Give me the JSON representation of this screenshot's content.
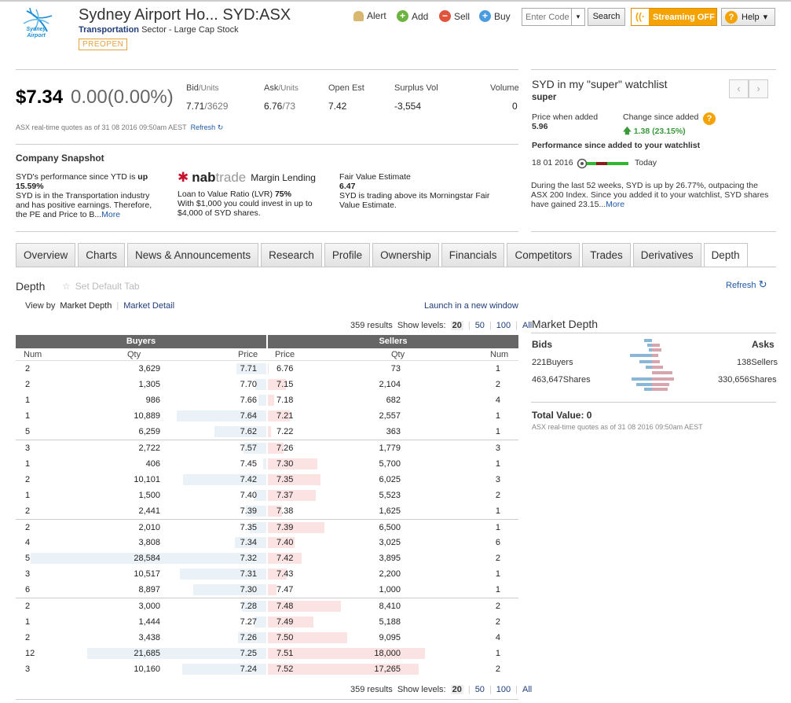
{
  "header": {
    "logo_text": "Sydney Airport",
    "title": "Sydney Airport Ho... SYD:ASX",
    "sector_bold": "Transportation",
    "sector_rest": "Sector - Large Cap Stock",
    "status": "PREOPEN",
    "actions": [
      "Alert",
      "Add",
      "Sell",
      "Buy"
    ],
    "code_placeholder": "Enter Code",
    "search_label": "Search",
    "streaming_label": "Streaming OFF",
    "help_label": "Help"
  },
  "quote": {
    "price": "$7.34",
    "change": "0.00(0.00%)",
    "bid_label": "Bid",
    "bid_unit": "/Units",
    "bid_value": "7.71",
    "bid_units": "/3629",
    "ask_label": "Ask",
    "ask_unit": "/Units",
    "ask_value": "6.76",
    "ask_units": "/73",
    "open_label": "Open Est",
    "open_value": "7.42",
    "surplus_label": "Surplus Vol",
    "surplus_value": "-3,554",
    "volume_label": "Volume",
    "volume_value": "0",
    "note": "ASX real-time quotes as of 31 08 2016 09:50am AEST",
    "refresh": "Refresh"
  },
  "snapshot": {
    "title": "Company Snapshot",
    "col1_a": "SYD's performance since YTD is ",
    "col1_b": "up 15.59%",
    "col1_c": "SYD is in the Transportation industry and has positive earnings. Therefore, the PE and Price to B...",
    "col1_more": "More",
    "nab_brand_a": "nab",
    "nab_brand_b": "trade",
    "nab_product": "Margin Lending",
    "nab_lvr_a": "Loan to Value Ratio (LVR) ",
    "nab_lvr_b": "75%",
    "nab_text": "With $1,000 you could invest in up to $4,000 of SYD shares.",
    "fv_label": "Fair Value Estimate",
    "fv_value": "6.47",
    "fv_text": "SYD is trading above its Morningstar Fair Value Estimate."
  },
  "watchlist": {
    "title": "SYD in my \"super\" watchlist",
    "name": "super",
    "price_added_label": "Price when added",
    "price_added": "5.96",
    "change_label": "Change since added",
    "change_value": "1.38 (23.15%)",
    "perf_label": "Performance since added to your watchlist",
    "perf_start": "18 01 2016",
    "perf_end": "Today",
    "text": "During the last 52 weeks, SYD is up by 26.77%, outpacing the ASX 200 Index. Since you added it to your watchlist, SYD shares have gained 23.15...",
    "more": "More"
  },
  "tabs": [
    "Overview",
    "Charts",
    "News & Announcements",
    "Research",
    "Profile",
    "Ownership",
    "Financials",
    "Competitors",
    "Trades",
    "Derivatives",
    "Depth"
  ],
  "active_tab": "Depth",
  "depth": {
    "heading": "Depth",
    "set_default": "Set Default Tab",
    "refresh": "Refresh",
    "view_by": "View by",
    "view_active": "Market Depth",
    "view_other": "Market Detail",
    "launch": "Launch in a new window",
    "results": "359 results",
    "show_levels": "Show levels:",
    "levels": [
      "20",
      "50",
      "100",
      "All"
    ],
    "buyers_header": "Buyers",
    "sellers_header": "Sellers",
    "col_num": "Num",
    "col_qty": "Qty",
    "col_price": "Price",
    "buy_max_qty": 28584,
    "sell_max_qty": 18000,
    "rows": [
      {
        "bn": "2",
        "bq": "3,629",
        "bqv": 3629,
        "bp": "7.71",
        "sp": "6.76",
        "sq": "73",
        "sqv": 73,
        "sn": "1"
      },
      {
        "bn": "2",
        "bq": "1,305",
        "bqv": 1305,
        "bp": "7.70",
        "sp": "7.15",
        "sq": "2,104",
        "sqv": 2104,
        "sn": "2"
      },
      {
        "bn": "1",
        "bq": "986",
        "bqv": 986,
        "bp": "7.66",
        "sp": "7.18",
        "sq": "682",
        "sqv": 682,
        "sn": "4"
      },
      {
        "bn": "1",
        "bq": "10,889",
        "bqv": 10889,
        "bp": "7.64",
        "sp": "7.21",
        "sq": "2,557",
        "sqv": 2557,
        "sn": "1"
      },
      {
        "bn": "5",
        "bq": "6,259",
        "bqv": 6259,
        "bp": "7.62",
        "sp": "7.22",
        "sq": "363",
        "sqv": 363,
        "sn": "1"
      },
      {
        "bn": "3",
        "bq": "2,722",
        "bqv": 2722,
        "bp": "7.57",
        "sp": "7.26",
        "sq": "1,779",
        "sqv": 1779,
        "sn": "3"
      },
      {
        "bn": "1",
        "bq": "406",
        "bqv": 406,
        "bp": "7.45",
        "sp": "7.30",
        "sq": "5,700",
        "sqv": 5700,
        "sn": "1"
      },
      {
        "bn": "2",
        "bq": "10,101",
        "bqv": 10101,
        "bp": "7.42",
        "sp": "7.35",
        "sq": "6,025",
        "sqv": 6025,
        "sn": "3"
      },
      {
        "bn": "1",
        "bq": "1,500",
        "bqv": 1500,
        "bp": "7.40",
        "sp": "7.37",
        "sq": "5,523",
        "sqv": 5523,
        "sn": "2"
      },
      {
        "bn": "2",
        "bq": "2,441",
        "bqv": 2441,
        "bp": "7.39",
        "sp": "7.38",
        "sq": "1,625",
        "sqv": 1625,
        "sn": "1"
      },
      {
        "bn": "2",
        "bq": "2,010",
        "bqv": 2010,
        "bp": "7.35",
        "sp": "7.39",
        "sq": "6,500",
        "sqv": 6500,
        "sn": "1"
      },
      {
        "bn": "4",
        "bq": "3,808",
        "bqv": 3808,
        "bp": "7.34",
        "sp": "7.40",
        "sq": "3,025",
        "sqv": 3025,
        "sn": "6"
      },
      {
        "bn": "5",
        "bq": "28,584",
        "bqv": 28584,
        "bp": "7.32",
        "sp": "7.42",
        "sq": "3,895",
        "sqv": 3895,
        "sn": "2"
      },
      {
        "bn": "3",
        "bq": "10,517",
        "bqv": 10517,
        "bp": "7.31",
        "sp": "7.43",
        "sq": "2,200",
        "sqv": 2200,
        "sn": "1"
      },
      {
        "bn": "6",
        "bq": "8,897",
        "bqv": 8897,
        "bp": "7.30",
        "sp": "7.47",
        "sq": "1,000",
        "sqv": 1000,
        "sn": "1"
      },
      {
        "bn": "2",
        "bq": "3,000",
        "bqv": 3000,
        "bp": "7.28",
        "sp": "7.48",
        "sq": "8,410",
        "sqv": 8410,
        "sn": "2"
      },
      {
        "bn": "1",
        "bq": "1,444",
        "bqv": 1444,
        "bp": "7.27",
        "sp": "7.49",
        "sq": "5,188",
        "sqv": 5188,
        "sn": "2"
      },
      {
        "bn": "2",
        "bq": "3,438",
        "bqv": 3438,
        "bp": "7.26",
        "sp": "7.50",
        "sq": "9,095",
        "sqv": 9095,
        "sn": "4"
      },
      {
        "bn": "12",
        "bq": "21,685",
        "bqv": 21685,
        "bp": "7.25",
        "sp": "7.51",
        "sq": "18,000",
        "sqv": 18000,
        "sn": "1"
      },
      {
        "bn": "3",
        "bq": "10,160",
        "bqv": 10160,
        "bp": "7.24",
        "sp": "7.52",
        "sq": "17,265",
        "sqv": 17265,
        "sn": "2"
      }
    ]
  },
  "market_depth": {
    "title": "Market Depth",
    "bids": "Bids",
    "asks": "Asks",
    "buyers": "221Buyers",
    "sellers": "138Sellers",
    "buy_shares": "463,647Shares",
    "sell_shares": "330,656Shares",
    "total": "Total Value: 0",
    "note": "ASX real-time quotes as of 31 08 2016 09:50am AEST"
  },
  "colors": {
    "accent": "#f5a300",
    "link": "#1f5aa6",
    "buy_bar": "#eaf2f8",
    "sell_bar": "#fbe3e3"
  }
}
